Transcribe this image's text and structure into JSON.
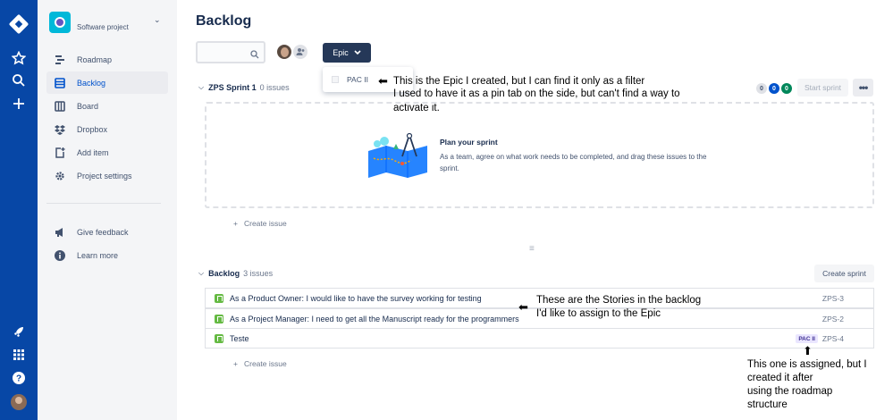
{
  "project": {
    "name": "Software project"
  },
  "sidebar": {
    "items": [
      {
        "label": "Roadmap",
        "icon": "roadmap-icon"
      },
      {
        "label": "Backlog",
        "icon": "backlog-icon",
        "active": true
      },
      {
        "label": "Board",
        "icon": "board-icon"
      },
      {
        "label": "Dropbox",
        "icon": "dropbox-icon"
      },
      {
        "label": "Add item",
        "icon": "add-item-icon"
      },
      {
        "label": "Project settings",
        "icon": "settings-icon"
      }
    ],
    "footer": [
      {
        "label": "Give feedback",
        "icon": "megaphone-icon"
      },
      {
        "label": "Learn more",
        "icon": "info-icon"
      }
    ]
  },
  "page": {
    "title": "Backlog"
  },
  "toolbar": {
    "epic_label": "Epic"
  },
  "epic_dropdown": {
    "options": [
      "PAC II"
    ]
  },
  "annotations": {
    "epic_note_line1": "This is the Epic I created, but I can find it only as a filter",
    "epic_note_line2": "I used to have it as a pin tab on the side, but can't find a way to",
    "epic_note_line3": "activate it.",
    "stories_note_line1": "These are the Stories in the backlog",
    "stories_note_line2": "I'd like to assign to the Epic",
    "assigned_note_line1": "This one is assigned, but I",
    "assigned_note_line2": "created it after",
    "assigned_note_line3": "using the roadmap",
    "assigned_note_line4": "structure"
  },
  "sprint": {
    "name": "ZPS Sprint 1",
    "count": "0 issues",
    "status_counts": [
      "0",
      "0",
      "0"
    ],
    "start_label": "Start sprint",
    "more_label": "•••",
    "empty_title": "Plan your sprint",
    "empty_desc": "As a team, agree on what work needs to be completed, and drag these issues to the sprint.",
    "create_issue": "Create issue"
  },
  "backlog": {
    "name": "Backlog",
    "count": "3 issues",
    "create_sprint": "Create sprint",
    "create_issue": "Create issue",
    "issues": [
      {
        "summary": "As a Product Owner: I would like to have the survey working for testing",
        "key": "ZPS-3",
        "epic": ""
      },
      {
        "summary": "As a Project Manager: I need to get all the Manuscript ready for the programmers",
        "key": "ZPS-2",
        "epic": ""
      },
      {
        "summary": "Teste",
        "key": "ZPS-4",
        "epic": "PAC II"
      }
    ]
  },
  "colors": {
    "global_nav": "#0747a6",
    "sidebar_bg": "#f4f5f7",
    "active_blue": "#0052cc",
    "story_green": "#65ba43",
    "epic_purple_bg": "#eae6ff",
    "epic_purple_text": "#403294",
    "pill_todo": "#dfe1e6",
    "pill_inprogress": "#0052cc",
    "pill_done": "#00875a"
  }
}
